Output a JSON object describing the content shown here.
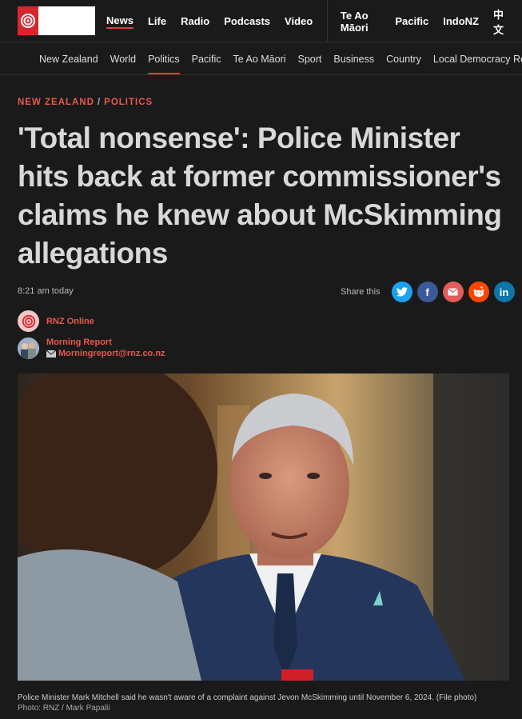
{
  "topnav": {
    "items": [
      "News",
      "Life",
      "Radio",
      "Podcasts",
      "Video"
    ],
    "items_right": [
      "Te Ao Māori",
      "Pacific",
      "IndoNZ",
      "中文"
    ]
  },
  "subnav": {
    "items": [
      "New Zealand",
      "World",
      "Politics",
      "Pacific",
      "Te Ao Māori",
      "Sport",
      "Business",
      "Country",
      "Local Democracy Reporting"
    ]
  },
  "article": {
    "breadcrumb_section": "NEW ZEALAND",
    "breadcrumb_sub": "POLITICS",
    "headline": "'Total nonsense': Police Minister hits back at former commissioner's claims he knew about McSkimming allegations",
    "time": "8:21 am today",
    "share_label": "Share this",
    "authors": [
      {
        "name": "RNZ Online"
      },
      {
        "name": "Morning Report",
        "email": "Morningreport@rnz.co.nz"
      }
    ],
    "caption": "Police Minister Mark Mitchell said he wasn't aware of a complaint against Jevon McSkimming until November 6, 2024. (File photo)",
    "credit": "Photo: RNZ / Mark Papalii"
  },
  "share_icons": [
    {
      "icon": "twitter-icon",
      "color": "#1da1f2"
    },
    {
      "icon": "facebook-icon",
      "color": "#3b5998"
    },
    {
      "icon": "email-icon",
      "color": "#e35b5b"
    },
    {
      "icon": "reddit-icon",
      "color": "#ff4500"
    },
    {
      "icon": "linkedin-icon",
      "color": "#0e76a8"
    }
  ],
  "colors": {
    "accent": "#e03a3e",
    "brand_red": "#d8262e",
    "byline": "#e8584c"
  }
}
